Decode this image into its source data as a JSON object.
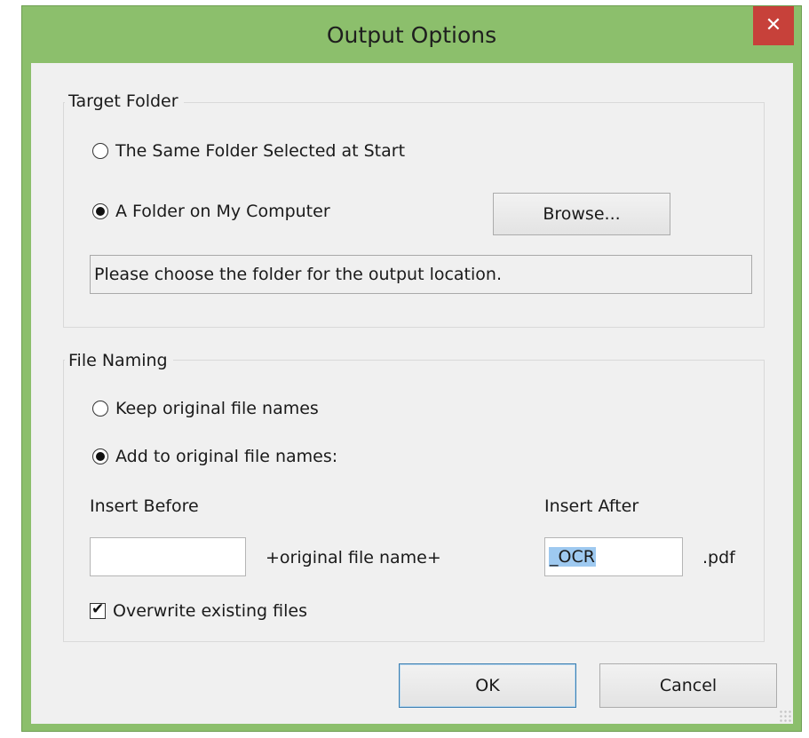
{
  "window": {
    "title": "Output Options",
    "close_glyph": "✕",
    "accent_color": "#8cbf6c",
    "close_color": "#c7413a"
  },
  "target_folder": {
    "group_title": "Target Folder",
    "options": [
      {
        "label": "The Same Folder Selected at Start",
        "selected": false
      },
      {
        "label": "A Folder on My Computer",
        "selected": true
      }
    ],
    "browse_label": "Browse...",
    "path_text": "Please choose the folder for the output location."
  },
  "file_naming": {
    "group_title": "File Naming",
    "options": [
      {
        "label": "Keep original file names",
        "selected": false
      },
      {
        "label": "Add to original file names:",
        "selected": true
      }
    ],
    "insert_before_label": "Insert Before",
    "insert_before_value": "",
    "middle_text": "+original file name+",
    "insert_after_label": "Insert After",
    "insert_after_value": "_OCR",
    "extension_text": ".pdf",
    "overwrite_label": "Overwrite existing files",
    "overwrite_checked": true
  },
  "footer": {
    "ok_label": "OK",
    "cancel_label": "Cancel"
  }
}
